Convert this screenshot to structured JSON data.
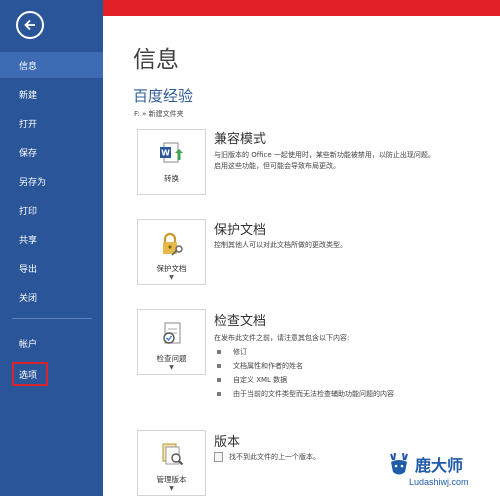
{
  "sidebar": {
    "items": [
      {
        "label": "信息"
      },
      {
        "label": "新建"
      },
      {
        "label": "打开"
      },
      {
        "label": "保存"
      },
      {
        "label": "另存为"
      },
      {
        "label": "打印"
      },
      {
        "label": "共享"
      },
      {
        "label": "导出"
      },
      {
        "label": "关闭"
      },
      {
        "label": "帐户"
      },
      {
        "label": "选项"
      }
    ],
    "active": "信息",
    "highlighted": "选项"
  },
  "colors": {
    "sidebar": "#2a5699",
    "topbar": "#e21f26",
    "highlight_outline": "#d9242b",
    "accent_text": "#2e5b9a"
  },
  "main": {
    "title": "信息",
    "doc_name": "百度经验",
    "doc_path": "F: » 新建文件夹",
    "sections": [
      {
        "button_label": "转换",
        "icon": "word-convert-icon",
        "title": "兼容模式",
        "desc_lines": [
          "与旧版本的 Office 一起使用时，某些新功能被禁用，以防止出现问题。",
          "启用这些功能，但可能会导致布局更改。"
        ]
      },
      {
        "button_label": "保护文档",
        "icon": "lock-key-icon",
        "title": "保护文档",
        "desc_lines": [
          "控制其他人可以对此文档所做的更改类型。"
        ]
      },
      {
        "button_label": "检查问题",
        "icon": "inspect-document-icon",
        "title": "检查文档",
        "desc_lines": [
          "在发布此文件之前，请注意其包含以下内容:"
        ],
        "bullets": [
          "修订",
          "文档属性和作者的姓名",
          "自定义 XML 数据",
          "由于当前的文件类型而无法检查辅助功能问题的内容"
        ]
      },
      {
        "button_label": "管理版本",
        "icon": "version-search-icon",
        "title": "版本",
        "desc_lines": [
          "找不到此文件的上一个版本。"
        ]
      }
    ]
  },
  "watermark": {
    "title": "鹿大师",
    "subtitle": "Ludashiwj.com"
  }
}
